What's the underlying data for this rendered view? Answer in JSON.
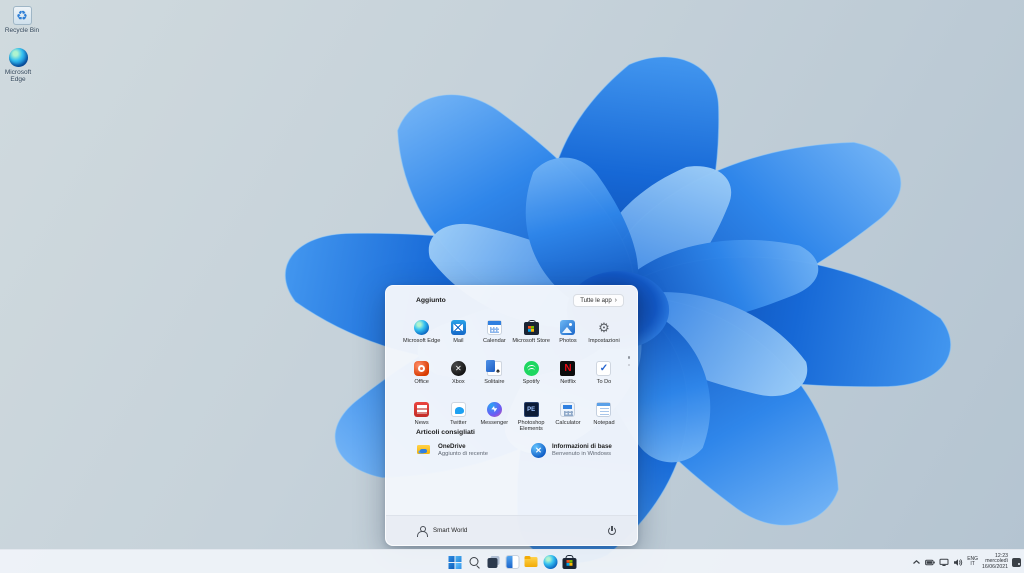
{
  "desktop": {
    "icons": [
      {
        "label": "Recycle Bin",
        "icon": "recycle-bin-icon"
      },
      {
        "label": "Microsoft Edge",
        "icon": "microsoft-edge-icon"
      }
    ]
  },
  "start_menu": {
    "pinned_header": "Aggiunto",
    "all_apps_label": "Tutte le app",
    "all_apps_chevron": "›",
    "apps": [
      {
        "name": "Microsoft Edge",
        "icon": "microsoft-edge-icon"
      },
      {
        "name": "Mail",
        "icon": "mail-icon"
      },
      {
        "name": "Calendar",
        "icon": "calendar-icon"
      },
      {
        "name": "Microsoft Store",
        "icon": "microsoft-store-icon"
      },
      {
        "name": "Photos",
        "icon": "photos-icon"
      },
      {
        "name": "Impostazioni",
        "icon": "settings-gear-icon"
      },
      {
        "name": "Office",
        "icon": "office-icon"
      },
      {
        "name": "Xbox",
        "icon": "xbox-icon"
      },
      {
        "name": "Solitaire",
        "icon": "solitaire-icon"
      },
      {
        "name": "Spotify",
        "icon": "spotify-icon"
      },
      {
        "name": "Netflix",
        "icon": "netflix-icon"
      },
      {
        "name": "To Do",
        "icon": "todo-icon"
      },
      {
        "name": "News",
        "icon": "news-icon"
      },
      {
        "name": "Twitter",
        "icon": "twitter-icon"
      },
      {
        "name": "Messenger",
        "icon": "messenger-icon"
      },
      {
        "name": "Photoshop Elements",
        "icon": "photoshop-elements-icon"
      },
      {
        "name": "Calculator",
        "icon": "calculator-icon"
      },
      {
        "name": "Notepad",
        "icon": "notepad-icon"
      }
    ],
    "recommended_header": "Articoli consigliati",
    "recommended": [
      {
        "title": "OneDrive",
        "subtitle": "Aggiunto di recente",
        "icon": "onedrive-icon"
      },
      {
        "title": "Informazioni di base",
        "subtitle": "Benvenuto in Windows",
        "icon": "get-started-icon"
      }
    ],
    "user_name": "Smart World"
  },
  "taskbar": {
    "buttons": [
      {
        "icon": "start-icon"
      },
      {
        "icon": "search-icon"
      },
      {
        "icon": "task-view-icon"
      },
      {
        "icon": "widgets-icon"
      },
      {
        "icon": "file-explorer-icon"
      },
      {
        "icon": "microsoft-edge-icon"
      },
      {
        "icon": "microsoft-store-icon"
      }
    ],
    "tray": {
      "language_top": "ENG",
      "language_bottom": "IT",
      "time": "12:23",
      "weekday": "mercoledì",
      "date": "16/06/2021"
    }
  },
  "colors": {
    "accent": "#0b57c2",
    "menu_bg": "#f3f6fb",
    "taskbar_bg": "#eff3f9",
    "bloom_dark": "#0a3e9b",
    "bloom_light": "#8ac4f7"
  }
}
